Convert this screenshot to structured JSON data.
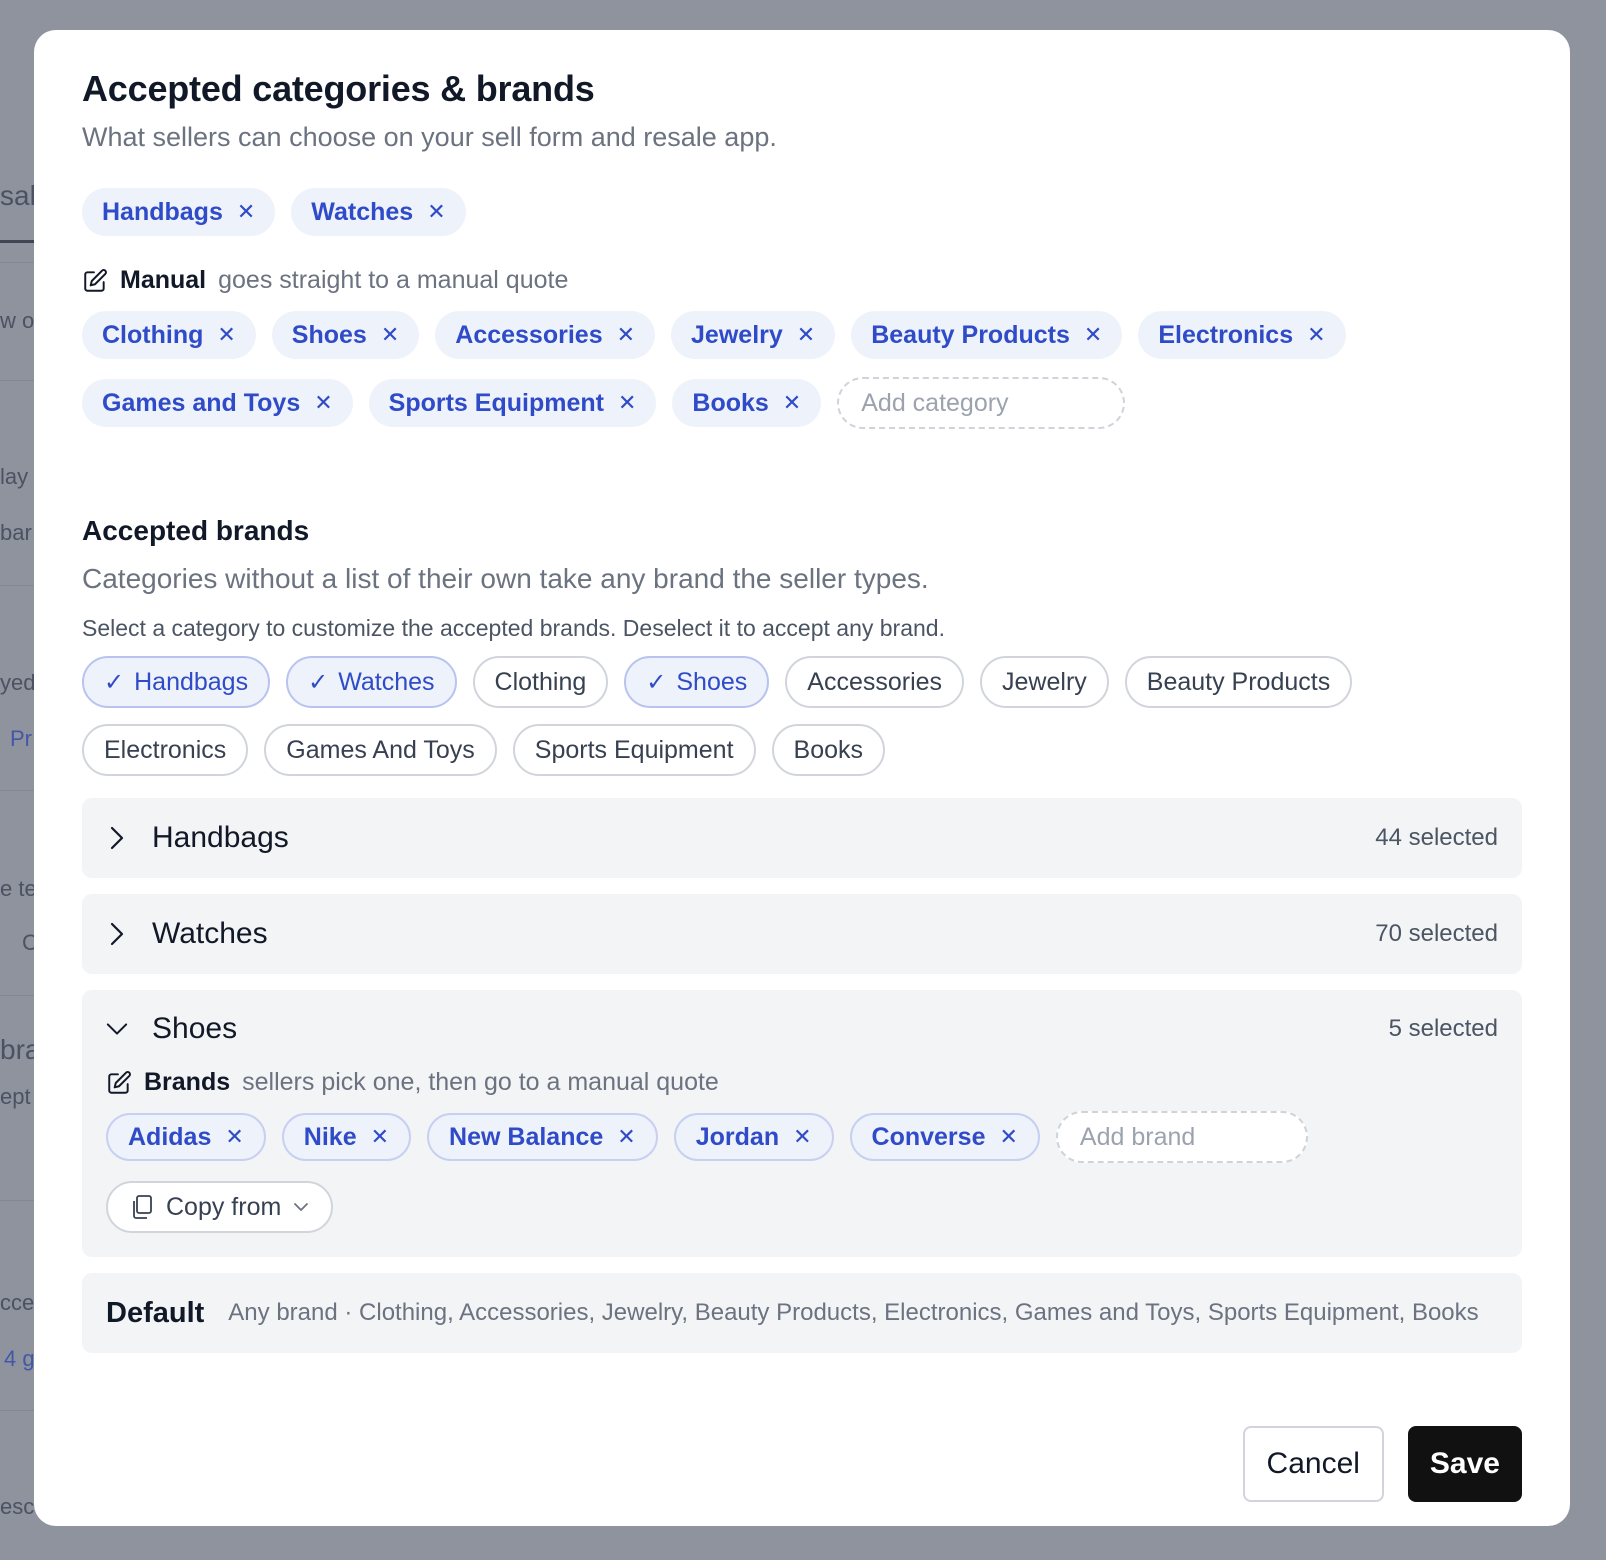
{
  "background": {
    "fragments": [
      "sal",
      "w o",
      "lay",
      "bar",
      "yed",
      "Pr",
      "e te",
      "C",
      "bra",
      "ept",
      "cce",
      "4 g",
      "escr"
    ]
  },
  "modal": {
    "title": "Accepted categories & brands",
    "subtitle": "What sellers can choose on your sell form and resale app."
  },
  "top_categories": [
    {
      "label": "Handbags"
    },
    {
      "label": "Watches"
    }
  ],
  "manual": {
    "label": "Manual",
    "description": "goes straight to a manual quote",
    "categories_row1": [
      "Clothing",
      "Shoes",
      "Accessories",
      "Jewelry",
      "Beauty Products",
      "Electronics"
    ],
    "categories_row2": [
      "Games and Toys",
      "Sports Equipment",
      "Books"
    ],
    "add_placeholder": "Add category"
  },
  "brands_section": {
    "title": "Accepted brands",
    "subtitle": "Categories without a list of their own take any brand the seller types.",
    "hint": "Select a category to customize the accepted brands. Deselect it to accept any brand.",
    "pills": [
      {
        "label": "Handbags",
        "selected": true
      },
      {
        "label": "Watches",
        "selected": true
      },
      {
        "label": "Clothing",
        "selected": false
      },
      {
        "label": "Shoes",
        "selected": true
      },
      {
        "label": "Accessories",
        "selected": false
      },
      {
        "label": "Jewelry",
        "selected": false
      },
      {
        "label": "Beauty Products",
        "selected": false
      },
      {
        "label": "Electronics",
        "selected": false
      },
      {
        "label": "Games And Toys",
        "selected": false
      },
      {
        "label": "Sports Equipment",
        "selected": false
      },
      {
        "label": "Books",
        "selected": false
      }
    ]
  },
  "accordions": [
    {
      "name": "Handbags",
      "count": "44 selected",
      "open": false
    },
    {
      "name": "Watches",
      "count": "70 selected",
      "open": false
    },
    {
      "name": "Shoes",
      "count": "5 selected",
      "open": true
    }
  ],
  "shoes_panel": {
    "label": "Brands",
    "description": "sellers pick one, then go to a manual quote",
    "brands": [
      "Adidas",
      "Nike",
      "New Balance",
      "Jordan",
      "Converse"
    ],
    "add_placeholder": "Add brand",
    "copy_label": "Copy from"
  },
  "default_row": {
    "label": "Default",
    "description": "Any brand · Clothing, Accessories, Jewelry, Beauty Products, Electronics, Games and Toys, Sports Equipment, Books"
  },
  "footer": {
    "cancel_label": "Cancel",
    "save_label": "Save"
  },
  "colors": {
    "accent": "#2f4bc7",
    "chip_bg": "#eef2fb",
    "overlay": "#8f939d",
    "save_bg": "#111111"
  }
}
